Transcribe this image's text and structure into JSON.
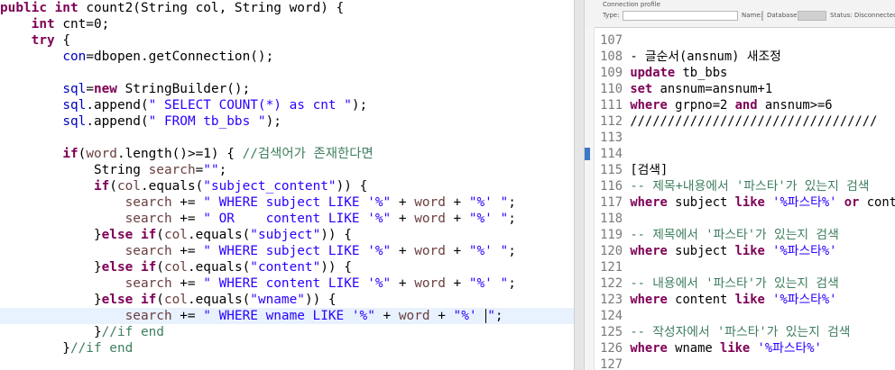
{
  "java_editor": {
    "lines": [
      [
        {
          "t": "public int ",
          "c": "kw"
        },
        {
          "t": "count2(String col, String word) {",
          "c": ""
        }
      ],
      [
        {
          "t": "    "
        },
        {
          "t": "int ",
          "c": "kw"
        },
        {
          "t": "cnt=0;",
          "c": ""
        }
      ],
      [
        {
          "t": "    "
        },
        {
          "t": "try",
          "c": "kw"
        },
        {
          "t": " {",
          "c": ""
        }
      ],
      [
        {
          "t": "        "
        },
        {
          "t": "con",
          "c": "fld"
        },
        {
          "t": "=dbopen.getConnection();",
          "c": ""
        }
      ],
      [
        {
          "t": ""
        }
      ],
      [
        {
          "t": "        "
        },
        {
          "t": "sql",
          "c": "fld"
        },
        {
          "t": "=",
          "c": ""
        },
        {
          "t": "new ",
          "c": "kw"
        },
        {
          "t": "StringBuilder();",
          "c": ""
        }
      ],
      [
        {
          "t": "        "
        },
        {
          "t": "sql",
          "c": "fld"
        },
        {
          "t": ".append(",
          "c": ""
        },
        {
          "t": "\" SELECT COUNT(*) as cnt \"",
          "c": "str"
        },
        {
          "t": ");",
          "c": ""
        }
      ],
      [
        {
          "t": "        "
        },
        {
          "t": "sql",
          "c": "fld"
        },
        {
          "t": ".append(",
          "c": ""
        },
        {
          "t": "\" FROM tb_bbs \"",
          "c": "str"
        },
        {
          "t": ");",
          "c": ""
        }
      ],
      [
        {
          "t": ""
        }
      ],
      [
        {
          "t": "        "
        },
        {
          "t": "if",
          "c": "kw"
        },
        {
          "t": "(",
          "c": ""
        },
        {
          "t": "word",
          "c": "var"
        },
        {
          "t": ".length()>=1) { ",
          "c": ""
        },
        {
          "t": "//검색어가 존재한다면",
          "c": "cmt"
        }
      ],
      [
        {
          "t": "            String "
        },
        {
          "t": "search",
          "c": "var"
        },
        {
          "t": "=",
          "c": ""
        },
        {
          "t": "\"\"",
          "c": "str"
        },
        {
          "t": ";",
          "c": ""
        }
      ],
      [
        {
          "t": "            "
        },
        {
          "t": "if",
          "c": "kw"
        },
        {
          "t": "(",
          "c": ""
        },
        {
          "t": "col",
          "c": "var"
        },
        {
          "t": ".equals(",
          "c": ""
        },
        {
          "t": "\"subject_content\"",
          "c": "str"
        },
        {
          "t": ")) {",
          "c": ""
        }
      ],
      [
        {
          "t": "                "
        },
        {
          "t": "search",
          "c": "var"
        },
        {
          "t": " += ",
          "c": ""
        },
        {
          "t": "\" WHERE subject LIKE '%\"",
          "c": "str"
        },
        {
          "t": " + ",
          "c": ""
        },
        {
          "t": "word",
          "c": "var"
        },
        {
          "t": " + ",
          "c": ""
        },
        {
          "t": "\"%' \"",
          "c": "str"
        },
        {
          "t": ";",
          "c": ""
        }
      ],
      [
        {
          "t": "                "
        },
        {
          "t": "search",
          "c": "var"
        },
        {
          "t": " += ",
          "c": ""
        },
        {
          "t": "\" OR    content LIKE '%\"",
          "c": "str"
        },
        {
          "t": " + ",
          "c": ""
        },
        {
          "t": "word",
          "c": "var"
        },
        {
          "t": " + ",
          "c": ""
        },
        {
          "t": "\"%' \"",
          "c": "str"
        },
        {
          "t": ";",
          "c": ""
        }
      ],
      [
        {
          "t": "            }"
        },
        {
          "t": "else if",
          "c": "kw"
        },
        {
          "t": "(",
          "c": ""
        },
        {
          "t": "col",
          "c": "var"
        },
        {
          "t": ".equals(",
          "c": ""
        },
        {
          "t": "\"subject\"",
          "c": "str"
        },
        {
          "t": ")) {",
          "c": ""
        }
      ],
      [
        {
          "t": "                "
        },
        {
          "t": "search",
          "c": "var"
        },
        {
          "t": " += ",
          "c": ""
        },
        {
          "t": "\" WHERE subject LIKE '%\"",
          "c": "str"
        },
        {
          "t": " + ",
          "c": ""
        },
        {
          "t": "word",
          "c": "var"
        },
        {
          "t": " + ",
          "c": ""
        },
        {
          "t": "\"%' \"",
          "c": "str"
        },
        {
          "t": ";",
          "c": ""
        }
      ],
      [
        {
          "t": "            }"
        },
        {
          "t": "else if",
          "c": "kw"
        },
        {
          "t": "(",
          "c": ""
        },
        {
          "t": "col",
          "c": "var"
        },
        {
          "t": ".equals(",
          "c": ""
        },
        {
          "t": "\"content\"",
          "c": "str"
        },
        {
          "t": ")) {",
          "c": ""
        }
      ],
      [
        {
          "t": "                "
        },
        {
          "t": "search",
          "c": "var"
        },
        {
          "t": " += ",
          "c": ""
        },
        {
          "t": "\" WHERE content LIKE '%\"",
          "c": "str"
        },
        {
          "t": " + ",
          "c": ""
        },
        {
          "t": "word",
          "c": "var"
        },
        {
          "t": " + ",
          "c": ""
        },
        {
          "t": "\"%' \"",
          "c": "str"
        },
        {
          "t": ";",
          "c": ""
        }
      ],
      [
        {
          "t": "            }"
        },
        {
          "t": "else if",
          "c": "kw"
        },
        {
          "t": "(",
          "c": ""
        },
        {
          "t": "col",
          "c": "var"
        },
        {
          "t": ".equals(",
          "c": ""
        },
        {
          "t": "\"wname\"",
          "c": "str"
        },
        {
          "t": ")) {",
          "c": ""
        }
      ],
      [
        {
          "t": "                "
        },
        {
          "t": "search",
          "c": "var"
        },
        {
          "t": " += ",
          "c": ""
        },
        {
          "t": "\" WHERE wname LIKE '%\"",
          "c": "str"
        },
        {
          "t": " + ",
          "c": ""
        },
        {
          "t": "word",
          "c": "var"
        },
        {
          "t": " + ",
          "c": ""
        },
        {
          "t": "\"%' ",
          "c": "str"
        },
        {
          "t": "CARET",
          "c": "caret"
        },
        {
          "t": "\"",
          "c": "str"
        },
        {
          "t": ";",
          "c": ""
        }
      ],
      [
        {
          "t": "            }"
        },
        {
          "t": "//if end",
          "c": "cmt"
        }
      ],
      [
        {
          "t": "        }"
        },
        {
          "t": "//if end",
          "c": "cmt"
        }
      ]
    ],
    "current_line_index": 19
  },
  "connection_profile": {
    "title": "Connection profile",
    "type_label": "Type:",
    "name_label": "Name:",
    "database_label": "Database:",
    "status_label": "Status: Disconnected, A"
  },
  "sql_editor": {
    "lines": [
      {
        "n": "107",
        "parts": []
      },
      {
        "n": "108",
        "parts": [
          {
            "t": "- 글순서(ansnum) 새조정",
            "c": "sql-txt"
          }
        ]
      },
      {
        "n": "109",
        "parts": [
          {
            "t": "update",
            "c": "sql-kw"
          },
          {
            "t": " tb_bbs",
            "c": "sql-txt"
          }
        ]
      },
      {
        "n": "110",
        "parts": [
          {
            "t": "set",
            "c": "sql-kw"
          },
          {
            "t": " ansnum=ansnum+1",
            "c": "sql-txt"
          }
        ]
      },
      {
        "n": "111",
        "parts": [
          {
            "t": "where",
            "c": "sql-kw"
          },
          {
            "t": " grpno=2 ",
            "c": "sql-txt"
          },
          {
            "t": "and",
            "c": "sql-kw"
          },
          {
            "t": " ansnum>=6",
            "c": "sql-txt"
          }
        ]
      },
      {
        "n": "112",
        "parts": [
          {
            "t": "/////////////////////////////////",
            "c": "sql-txt"
          }
        ]
      },
      {
        "n": "113",
        "parts": []
      },
      {
        "n": "114",
        "parts": []
      },
      {
        "n": "115",
        "parts": [
          {
            "t": "[검색]",
            "c": "sql-txt"
          }
        ]
      },
      {
        "n": "116",
        "parts": [
          {
            "t": "-- 제목+내용에서 '파스타'가 있는지 검색",
            "c": "sql-cmt"
          }
        ]
      },
      {
        "n": "117",
        "parts": [
          {
            "t": "where",
            "c": "sql-kw"
          },
          {
            "t": " subject ",
            "c": "sql-txt"
          },
          {
            "t": "like",
            "c": "sql-kw"
          },
          {
            "t": " '%파스타%' ",
            "c": "sql-str"
          },
          {
            "t": "or",
            "c": "sql-kw"
          },
          {
            "t": " cont",
            "c": "sql-txt"
          }
        ]
      },
      {
        "n": "118",
        "parts": []
      },
      {
        "n": "119",
        "parts": [
          {
            "t": "-- 제목에서 '파스타'가 있는지 검색",
            "c": "sql-cmt"
          }
        ]
      },
      {
        "n": "120",
        "parts": [
          {
            "t": "where",
            "c": "sql-kw"
          },
          {
            "t": " subject ",
            "c": "sql-txt"
          },
          {
            "t": "like",
            "c": "sql-kw"
          },
          {
            "t": " '%파스타%'",
            "c": "sql-str"
          }
        ]
      },
      {
        "n": "121",
        "parts": []
      },
      {
        "n": "122",
        "parts": [
          {
            "t": "-- 내용에서 '파스타'가 있는지 검색",
            "c": "sql-cmt"
          }
        ]
      },
      {
        "n": "123",
        "parts": [
          {
            "t": "where",
            "c": "sql-kw"
          },
          {
            "t": " content ",
            "c": "sql-txt"
          },
          {
            "t": "like",
            "c": "sql-kw"
          },
          {
            "t": " '%파스타%'",
            "c": "sql-str"
          }
        ]
      },
      {
        "n": "124",
        "parts": []
      },
      {
        "n": "125",
        "parts": [
          {
            "t": "-- 작성자에서 '파스타'가 있는지 검색",
            "c": "sql-cmt"
          }
        ]
      },
      {
        "n": "126",
        "parts": [
          {
            "t": "where",
            "c": "sql-kw"
          },
          {
            "t": " wname ",
            "c": "sql-txt"
          },
          {
            "t": "like",
            "c": "sql-kw"
          },
          {
            "t": " '%파스타%'",
            "c": "sql-str"
          }
        ]
      },
      {
        "n": "127",
        "parts": []
      }
    ]
  }
}
